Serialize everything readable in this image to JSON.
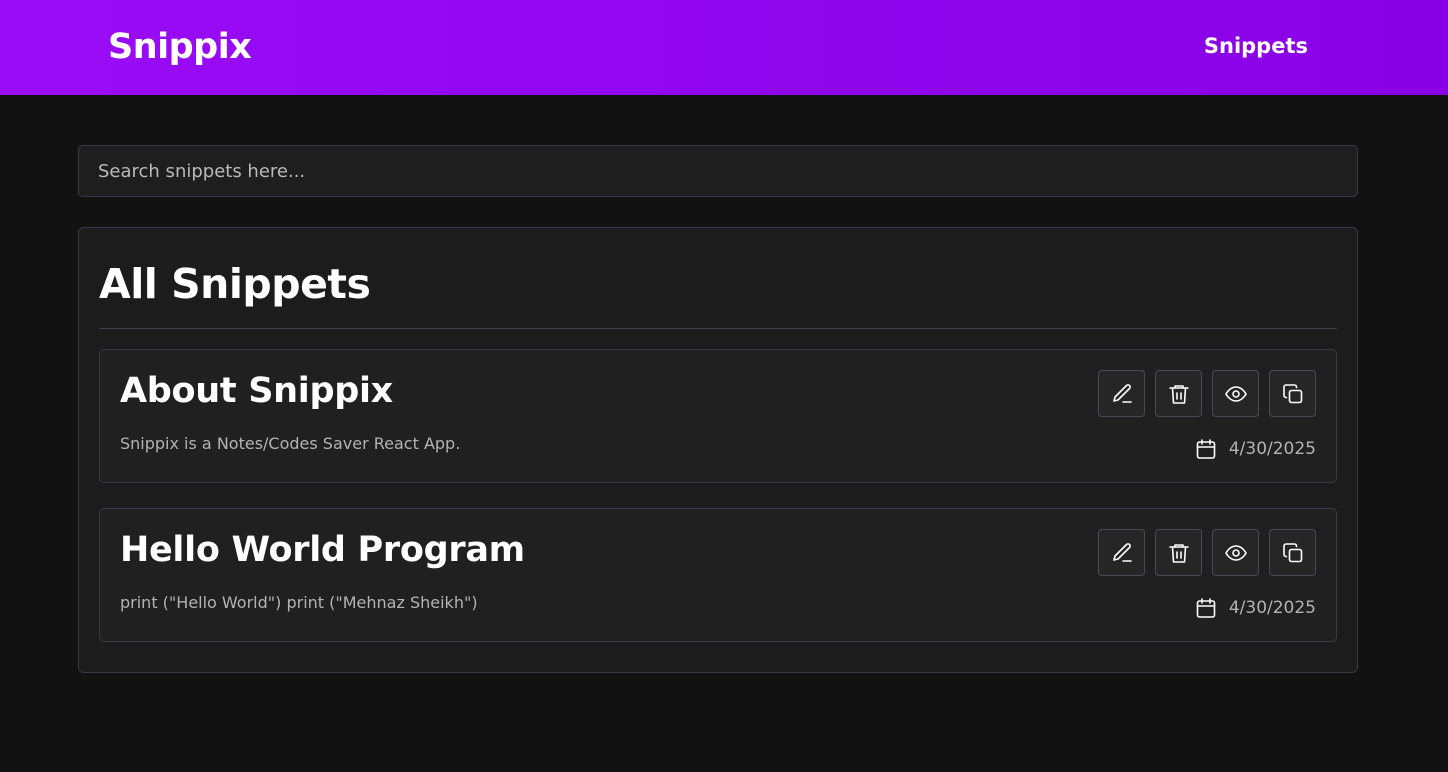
{
  "header": {
    "brand": "Snippix",
    "nav_link": "Snippets"
  },
  "search": {
    "value": "",
    "placeholder": "Search snippets here..."
  },
  "main": {
    "title": "All Snippets",
    "snippets": [
      {
        "title": "About Snippix",
        "description": "Snippix is a Notes/Codes Saver React App.",
        "date": "4/30/2025",
        "actions": [
          "edit-icon",
          "trash-icon",
          "eye-icon",
          "copy-icon"
        ]
      },
      {
        "title": "Hello World Program",
        "description": "print (\"Hello World\") print (\"Mehnaz Sheikh\")",
        "date": "4/30/2025",
        "actions": [
          "edit-icon",
          "trash-icon",
          "eye-icon",
          "copy-icon"
        ]
      }
    ]
  },
  "colors": {
    "header_gradient_start": "#9b0cf7",
    "header_gradient_end": "#8a00e6",
    "background": "#121212",
    "panel": "#1c1c1c",
    "card": "#202020",
    "border": "#3a3a44"
  }
}
